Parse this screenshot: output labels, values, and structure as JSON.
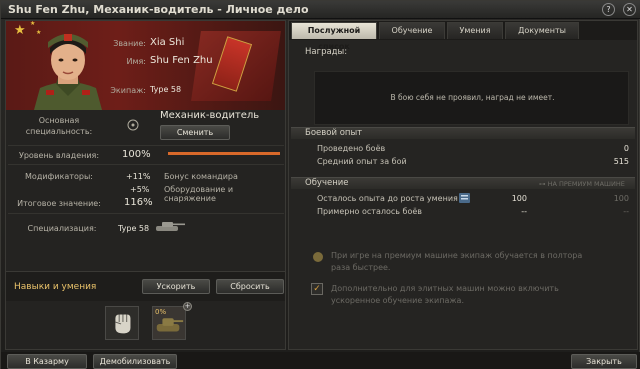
{
  "window": {
    "title": "Shu Fen Zhu, Механик-водитель - Личное дело"
  },
  "titlebar": {
    "help_icon": "?",
    "close_icon": "✕"
  },
  "profile": {
    "rank_label": "Звание:",
    "rank_value": "Xia Shi",
    "name_label": "Имя:",
    "name_value": "Shu Fen Zhu",
    "crew_label": "Экипаж:",
    "crew_value": "Type 58"
  },
  "specialty": {
    "label": "Основная специальность:",
    "value": "Механик-водитель",
    "change_button": "Сменить"
  },
  "mastery": {
    "label": "Уровень владения:",
    "value": "100%",
    "fill_fraction": 1.0
  },
  "modifiers": {
    "label": "Модификаторы:",
    "rows": [
      {
        "value": "+11%",
        "desc": "Бонус командира"
      },
      {
        "value": "+5%",
        "desc": "Оборудование и снаряжение"
      }
    ]
  },
  "final_value": {
    "label": "Итоговое значение:",
    "value": "116%"
  },
  "specialization": {
    "label": "Специализация:",
    "value": "Type 58"
  },
  "skills": {
    "title": "Навыки и умения",
    "accelerate_button": "Ускорить",
    "reset_button": "Сбросить",
    "new_skill_percent": "0%"
  },
  "tabs": [
    {
      "label": "Послужной список",
      "active": true
    },
    {
      "label": "Обучение",
      "active": false
    },
    {
      "label": "Умения",
      "active": false
    },
    {
      "label": "Документы",
      "active": false
    }
  ],
  "awards": {
    "title": "Награды:",
    "empty_text": "В бою себя не проявил, наград не имеет."
  },
  "combat": {
    "title": "Боевой опыт",
    "rows": [
      {
        "label": "Проведено боёв",
        "value": "0"
      },
      {
        "label": "Средний опыт за бой",
        "value": "515"
      }
    ]
  },
  "training": {
    "title": "Обучение",
    "premium_header": "НА ПРЕМИУМ МАШИНЕ",
    "rows": [
      {
        "label": "Осталось опыта до роста умения",
        "value": "100",
        "premium": "100"
      },
      {
        "label": "Примерно осталось боёв",
        "value": "--",
        "premium": "--"
      }
    ],
    "note_premium": "При игре на премиум машине экипаж обучается в полтора раза быстрее.",
    "note_elite": "Дополнительно для элитных машин можно включить ускоренное обучение экипажа."
  },
  "footer": {
    "barracks_button": "В Казарму",
    "demobilize_button": "Демобилизовать",
    "close_button": "Закрыть"
  },
  "colors": {
    "accent": "#e9c26a",
    "mastery_bar": "#d8692a",
    "flag_red": "#6e1e18"
  }
}
